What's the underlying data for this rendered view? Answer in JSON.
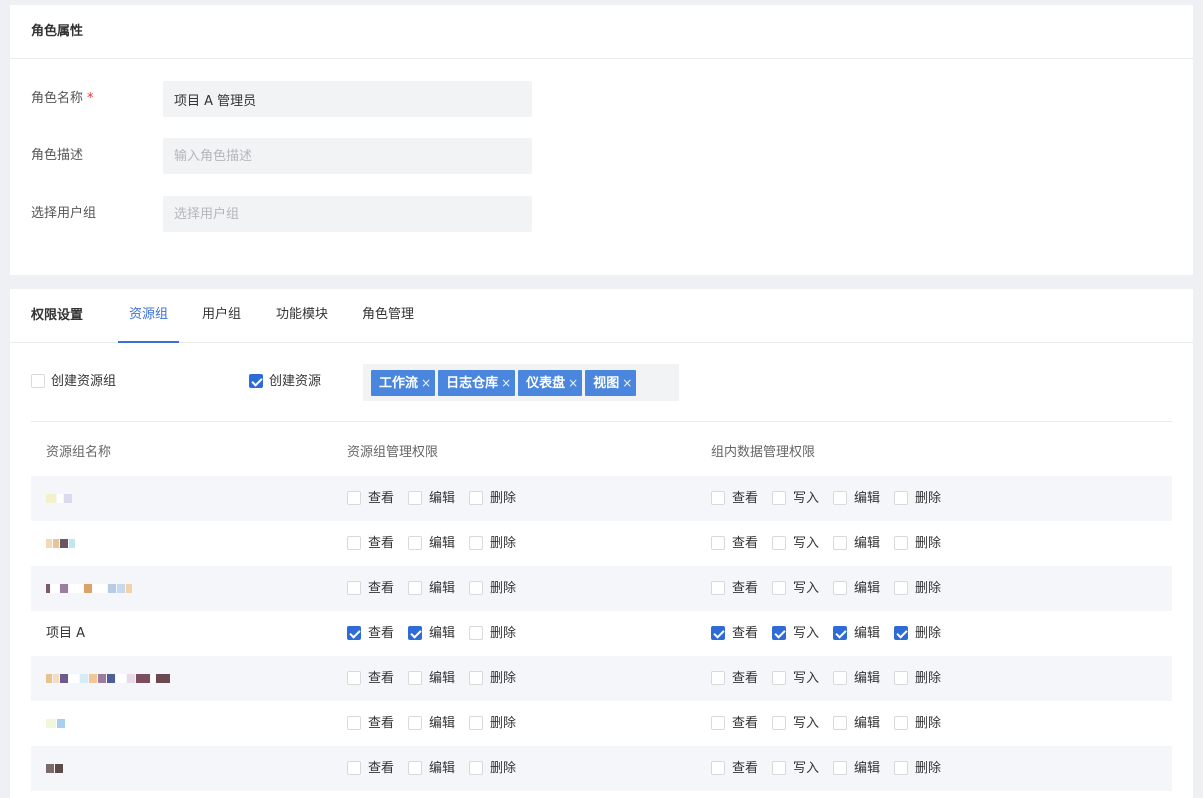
{
  "role_props": {
    "title": "角色属性",
    "fields": {
      "name": {
        "label": "角色名称",
        "required_mark": "*",
        "value": "项目 A 管理员"
      },
      "desc": {
        "label": "角色描述",
        "placeholder": "输入角色描述",
        "value": ""
      },
      "group": {
        "label": "选择用户组",
        "placeholder": "选择用户组",
        "value": ""
      }
    }
  },
  "permissions": {
    "title": "权限设置",
    "tabs": [
      {
        "label": "资源组",
        "active": true
      },
      {
        "label": "用户组",
        "active": false
      },
      {
        "label": "功能模块",
        "active": false
      },
      {
        "label": "角色管理",
        "active": false
      }
    ],
    "options": {
      "create_group": {
        "label": "创建资源组",
        "checked": false
      },
      "create_resource": {
        "label": "创建资源",
        "checked": true
      }
    },
    "tags": [
      {
        "label": "工作流",
        "close": "×"
      },
      {
        "label": "日志仓库",
        "close": "×"
      },
      {
        "label": "仪表盘",
        "close": "×"
      },
      {
        "label": "视图",
        "close": "×"
      }
    ],
    "table": {
      "headers": {
        "name": "资源组名称",
        "group_perm": "资源组管理权限",
        "data_perm": "组内数据管理权限"
      },
      "perm_labels": {
        "view": "查看",
        "edit": "编辑",
        "delete": "删除",
        "write": "写入"
      },
      "rows": [
        {
          "name": "",
          "group": [
            false,
            false,
            false
          ],
          "data": [
            false,
            false,
            false,
            false
          ]
        },
        {
          "name": "",
          "group": [
            false,
            false,
            false
          ],
          "data": [
            false,
            false,
            false,
            false
          ]
        },
        {
          "name": "",
          "group": [
            false,
            false,
            false
          ],
          "data": [
            false,
            false,
            false,
            false
          ]
        },
        {
          "name": "项目 A",
          "group": [
            true,
            true,
            false
          ],
          "data": [
            true,
            true,
            true,
            true
          ]
        },
        {
          "name": "",
          "group": [
            false,
            false,
            false
          ],
          "data": [
            false,
            false,
            false,
            false
          ]
        },
        {
          "name": "",
          "group": [
            false,
            false,
            false
          ],
          "data": [
            false,
            false,
            false,
            false
          ]
        },
        {
          "name": "",
          "group": [
            false,
            false,
            false
          ],
          "data": [
            false,
            false,
            false,
            false
          ]
        }
      ]
    }
  },
  "colors": {
    "accent": "#3a6fd8",
    "checkbox_checked": "#2f6bd6",
    "tag_bg": "#4a86de",
    "row_alt": "#f4f6fa"
  }
}
